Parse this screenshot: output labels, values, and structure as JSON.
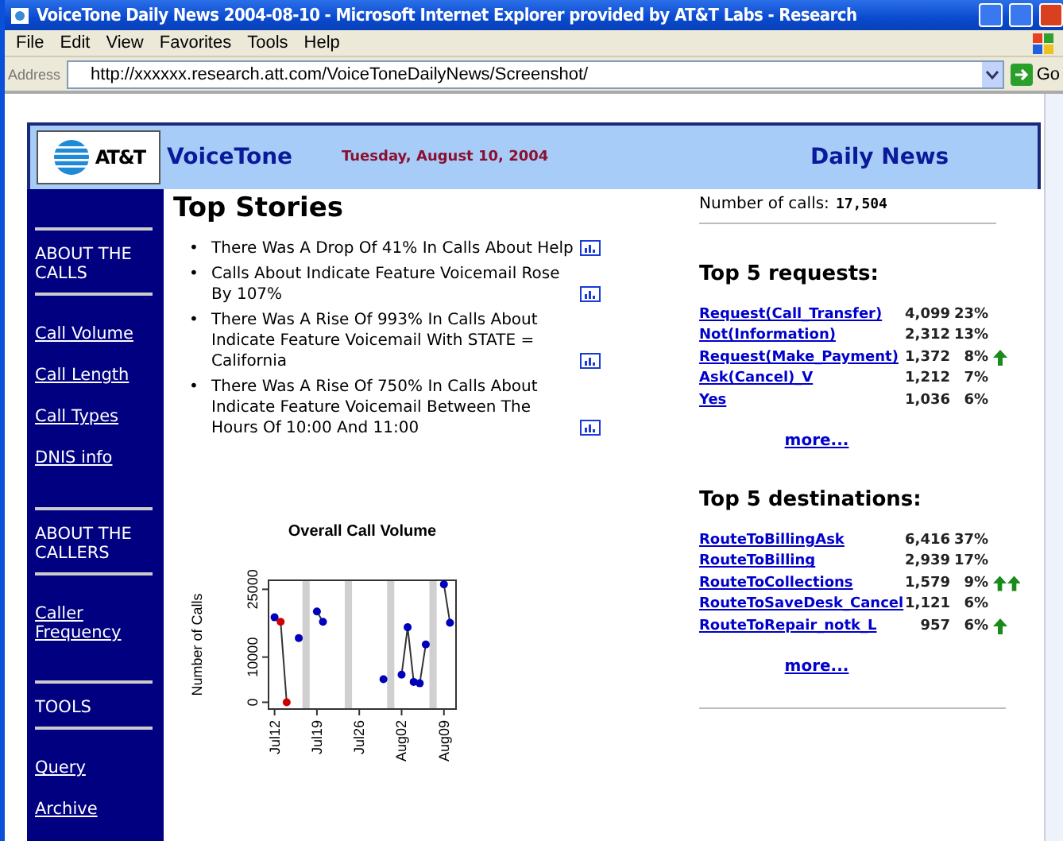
{
  "window": {
    "title": "VoiceTone Daily News 2004-08-10 - Microsoft Internet Explorer provided by AT&T Labs - Research",
    "menu": [
      "File",
      "Edit",
      "View",
      "Favorites",
      "Tools",
      "Help"
    ],
    "address_label": "Address",
    "url": "http://xxxxxx.research.att.com/VoiceToneDailyNews/Screenshot/",
    "go": "Go"
  },
  "header": {
    "logo": "AT&T",
    "app_name": "VoiceTone",
    "date": "Tuesday, August 10, 2004",
    "section": "Daily News"
  },
  "sidebar": [
    {
      "heading": "ABOUT THE CALLS",
      "links": [
        "Call Volume",
        "Call Length",
        "Call Types",
        "DNIS info"
      ]
    },
    {
      "heading": "ABOUT THE CALLERS",
      "links": [
        "Caller Frequency"
      ]
    },
    {
      "heading": "TOOLS",
      "links": [
        "Query",
        "Archive"
      ]
    }
  ],
  "top_stories": {
    "title": "Top Stories",
    "bullet": "•",
    "items": [
      "There Was A Drop Of 41% In Calls About Help",
      "Calls About Indicate Feature Voicemail Rose By 107%",
      "There Was A Rise Of 993% In Calls About Indicate Feature Voicemail With STATE = California",
      "There Was A Rise Of 750% In Calls About Indicate Feature Voicemail Between The Hours Of 10:00 And 11:00"
    ]
  },
  "chart": {
    "chart_data": {
      "type": "line",
      "title": "Overall Call Volume",
      "ylabel": "Number of Calls",
      "categories": [
        "Jul12",
        null,
        null,
        null,
        null,
        null,
        null,
        "Jul19",
        null,
        null,
        null,
        null,
        null,
        null,
        "Jul26",
        null,
        null,
        null,
        null,
        null,
        null,
        "Aug02",
        null,
        null,
        null,
        null,
        null,
        null,
        "Aug09",
        null
      ],
      "series": [
        {
          "color": "#0000bb",
          "marker": "circle",
          "values": [
            18800,
            null,
            null,
            null,
            14200,
            null,
            null,
            20100,
            17800,
            null,
            null,
            null,
            null,
            null,
            null,
            null,
            null,
            null,
            5100,
            null,
            null,
            6100,
            16600,
            4500,
            4200,
            12800,
            null,
            null,
            26100,
            17600
          ]
        },
        {
          "color": "#cc0000",
          "marker": "circle",
          "values": [
            null,
            17800,
            0,
            null,
            null,
            null,
            null,
            null,
            null,
            null,
            null,
            null,
            null,
            null,
            null,
            null,
            null,
            null,
            null,
            null,
            null,
            null,
            null,
            null,
            null,
            null,
            null,
            null,
            null,
            null
          ]
        }
      ],
      "ylim": [
        -1500,
        27000
      ],
      "yticks": [
        0,
        10000,
        25000
      ]
    }
  },
  "calls": {
    "label": "Number of calls:",
    "value": "17,504"
  },
  "requests": {
    "title": "Top 5 requests:",
    "rows": [
      {
        "name": "Request(Call_Transfer)",
        "count": "4,099",
        "pct": "23%",
        "arrow_up": false,
        "double_arrow": false
      },
      {
        "name": "Not(Information)",
        "count": "2,312",
        "pct": "13%",
        "arrow_up": false,
        "double_arrow": false
      },
      {
        "name": "Request(Make_Payment)",
        "count": "1,372",
        "pct": "8%",
        "arrow_up": true,
        "double_arrow": false
      },
      {
        "name": "Ask(Cancel)_V",
        "count": "1,212",
        "pct": "7%",
        "arrow_up": false,
        "double_arrow": false
      },
      {
        "name": "Yes",
        "count": "1,036",
        "pct": "6%",
        "arrow_up": false,
        "double_arrow": false
      }
    ],
    "more": "more..."
  },
  "destinations": {
    "title": "Top 5 destinations:",
    "rows": [
      {
        "name": "RouteToBillingAsk",
        "count": "6,416",
        "pct": "37%",
        "arrow_up": false,
        "double_arrow": false
      },
      {
        "name": "RouteToBilling",
        "count": "2,939",
        "pct": "17%",
        "arrow_up": false,
        "double_arrow": false
      },
      {
        "name": "RouteToCollections",
        "count": "1,579",
        "pct": "9%",
        "arrow_up": true,
        "double_arrow": true
      },
      {
        "name": "RouteToSaveDesk_Cancel",
        "count": "1,121",
        "pct": "6%",
        "arrow_up": false,
        "double_arrow": false
      },
      {
        "name": "RouteToRepair_notk_L",
        "count": "957",
        "pct": "6%",
        "arrow_up": true,
        "double_arrow": false
      }
    ],
    "more": "more..."
  }
}
